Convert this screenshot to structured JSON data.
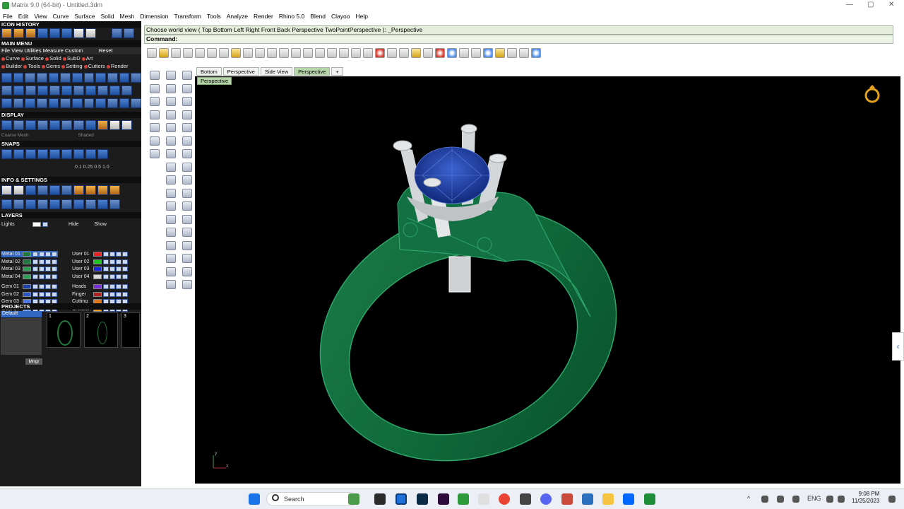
{
  "window": {
    "title": "Matrix 9.0 (64-bit) - Untitled.3dm",
    "min": "—",
    "max": "▢",
    "close": "✕"
  },
  "menu": [
    "File",
    "Edit",
    "View",
    "Curve",
    "Surface",
    "Solid",
    "Mesh",
    "Dimension",
    "Transform",
    "Tools",
    "Analyze",
    "Render",
    "Rhino 5.0",
    "Blend",
    "Clayoo",
    "Help"
  ],
  "panel": {
    "icon_history": "ICON HISTORY",
    "main_menu": "MAIN MENU",
    "main_menu_items": [
      "File",
      "View",
      "Utilities",
      "Measure",
      "Custom"
    ],
    "reset": "Reset",
    "mm_row1": [
      "Curve",
      "Surface",
      "Solid",
      "SubD",
      "Art"
    ],
    "mm_row2": [
      "Builder",
      "Tools",
      "Gems",
      "Setting",
      "Cutters",
      "Render"
    ],
    "display": "DISPLAY",
    "display_opt1": "Coarse Mesh",
    "display_opt2": "Shaded",
    "snaps": "SNAPS",
    "snap_values": [
      "0.1",
      "0.25",
      "0.5",
      "1.0"
    ],
    "info": "INFO & SETTINGS",
    "layers": "LAYERS",
    "lights": "Lights",
    "hide": "Hide",
    "show": "Show",
    "layers_left": [
      {
        "name": "Metal 01",
        "color": "#1f7a3f"
      },
      {
        "name": "Metal 02",
        "color": "#1f7a3f"
      },
      {
        "name": "Metal 03",
        "color": "#2e9c56"
      },
      {
        "name": "Metal 04",
        "color": "#2e9c56"
      },
      {
        "name": "Gem 01",
        "color": "#1b3fa8"
      },
      {
        "name": "Gem 02",
        "color": "#2d55c8"
      },
      {
        "name": "Gem 03",
        "color": "#4f78e0"
      },
      {
        "name": "Gem 04",
        "color": "#7aa0f0"
      }
    ],
    "layers_right": [
      {
        "name": "User 01",
        "color": "#e82222"
      },
      {
        "name": "User 02",
        "color": "#22c422"
      },
      {
        "name": "User 03",
        "color": "#1a2ae0"
      },
      {
        "name": "User 04",
        "color": "#d8d8d8"
      },
      {
        "name": "Heads",
        "color": "#7b2bd8"
      },
      {
        "name": "Finger",
        "color": "#b02020"
      },
      {
        "name": "Cutting",
        "color": "#e07820"
      },
      {
        "name": "Creation",
        "color": "#f0a020"
      }
    ],
    "projects": "PROJECTS",
    "project_default": "Default",
    "project_thumbs": [
      "1",
      "2",
      "3"
    ],
    "mngr": "Mngr"
  },
  "command": {
    "line1": "Choose world view ( Top  Bottom  Left  Right  Front  Back  Perspective  TwoPointPerspective ):  _Perspective",
    "line2": "Command:"
  },
  "viewport_tabs": [
    "Bottom",
    "Perspective",
    "Side View",
    "Perspective"
  ],
  "active_tab_index": 3,
  "viewport_label": "Perspective",
  "axes": {
    "y": "y",
    "x": "x"
  },
  "taskbar": {
    "search": "Search",
    "lang": "ENG",
    "time": "9:08 PM",
    "date": "11/25/2023"
  },
  "colors": {
    "ring": "#0f6b3a",
    "gem": "#1d3fa6",
    "prongs": "#cfd2d4",
    "panel_bg": "#1c1c1c"
  }
}
